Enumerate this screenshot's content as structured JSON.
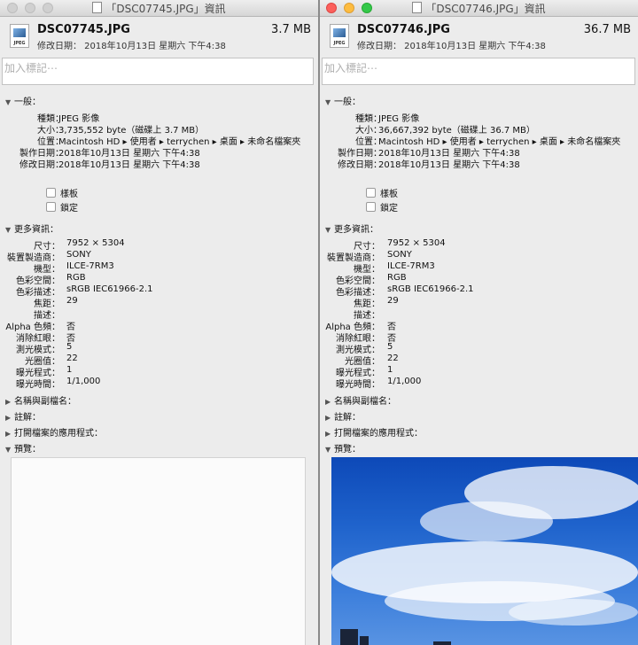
{
  "windows": [
    {
      "title": "「DSC07745.JPG」資訊",
      "file_name": "DSC07745.JPG",
      "file_size": "3.7 MB",
      "modified": "修改日期： 2018年10月13日 星期六 下午4:38",
      "tags_placeholder": "加入標記⋯",
      "general": {
        "header": "一般：",
        "rows": [
          {
            "label": "種類：",
            "value": "JPEG 影像"
          },
          {
            "label": "大小：",
            "value": "3,735,552 byte（磁碟上 3.7 MB）"
          },
          {
            "label": "位置：",
            "value": "Macintosh HD ▸ 使用者 ▸ terrychen ▸ 桌面 ▸ 未命名檔案夾"
          },
          {
            "label": "製作日期：",
            "value": "2018年10月13日 星期六 下午4:38"
          },
          {
            "label": "修改日期：",
            "value": "2018年10月13日 星期六 下午4:38"
          }
        ],
        "stationery": "樣板",
        "locked": "鎖定"
      },
      "more_info": {
        "header": "更多資訊：",
        "rows": [
          {
            "label": "尺寸：",
            "value": "7952 × 5304"
          },
          {
            "label": "裝置製造商：",
            "value": "SONY"
          },
          {
            "label": "機型：",
            "value": "ILCE-7RM3"
          },
          {
            "label": "色彩空間：",
            "value": "RGB"
          },
          {
            "label": "色彩描述：",
            "value": "sRGB IEC61966-2.1"
          },
          {
            "label": "焦距：",
            "value": "29"
          },
          {
            "label": "描述：",
            "value": ""
          },
          {
            "label": "Alpha 色頻：",
            "value": "否"
          },
          {
            "label": "消除紅眼：",
            "value": "否"
          },
          {
            "label": "測光模式：",
            "value": "5"
          },
          {
            "label": "光圈值：",
            "value": "22"
          },
          {
            "label": "曝光程式：",
            "value": "1"
          },
          {
            "label": "曝光時間：",
            "value": "1/1,000"
          }
        ]
      },
      "name_ext": "名稱與副檔名：",
      "comments": "註解：",
      "open_with": "打開檔案的應用程式：",
      "preview": "預覽：",
      "icon_ext": "JPEG"
    },
    {
      "title": "「DSC07746.JPG」資訊",
      "file_name": "DSC07746.JPG",
      "file_size": "36.7 MB",
      "modified": "修改日期： 2018年10月13日 星期六 下午4:38",
      "tags_placeholder": "加入標記⋯",
      "general": {
        "header": "一般：",
        "rows": [
          {
            "label": "種類：",
            "value": "JPEG 影像"
          },
          {
            "label": "大小：",
            "value": "36,667,392 byte（磁碟上 36.7 MB）"
          },
          {
            "label": "位置：",
            "value": "Macintosh HD ▸ 使用者 ▸ terrychen ▸ 桌面 ▸ 未命名檔案夾"
          },
          {
            "label": "製作日期：",
            "value": "2018年10月13日 星期六 下午4:38"
          },
          {
            "label": "修改日期：",
            "value": "2018年10月13日 星期六 下午4:38"
          }
        ],
        "stationery": "樣板",
        "locked": "鎖定"
      },
      "more_info": {
        "header": "更多資訊：",
        "rows": [
          {
            "label": "尺寸：",
            "value": "7952 × 5304"
          },
          {
            "label": "裝置製造商：",
            "value": "SONY"
          },
          {
            "label": "機型：",
            "value": "ILCE-7RM3"
          },
          {
            "label": "色彩空間：",
            "value": "RGB"
          },
          {
            "label": "色彩描述：",
            "value": "sRGB IEC61966-2.1"
          },
          {
            "label": "焦距：",
            "value": "29"
          },
          {
            "label": "描述：",
            "value": ""
          },
          {
            "label": "Alpha 色頻：",
            "value": "否"
          },
          {
            "label": "消除紅眼：",
            "value": "否"
          },
          {
            "label": "測光模式：",
            "value": "5"
          },
          {
            "label": "光圈值：",
            "value": "22"
          },
          {
            "label": "曝光程式：",
            "value": "1"
          },
          {
            "label": "曝光時間：",
            "value": "1/1,000"
          }
        ]
      },
      "name_ext": "名稱與副檔名：",
      "comments": "註解：",
      "open_with": "打開檔案的應用程式：",
      "preview": "預覽：",
      "icon_ext": "JPEG"
    }
  ],
  "icons": {
    "expanded": "▼",
    "collapsed": "▶"
  },
  "colors": {
    "close": "#fc605c",
    "minimize": "#fdbc40",
    "zoom": "#34c84a",
    "inactive_button": "#d0d0d0",
    "sky": "#1f63cc"
  }
}
